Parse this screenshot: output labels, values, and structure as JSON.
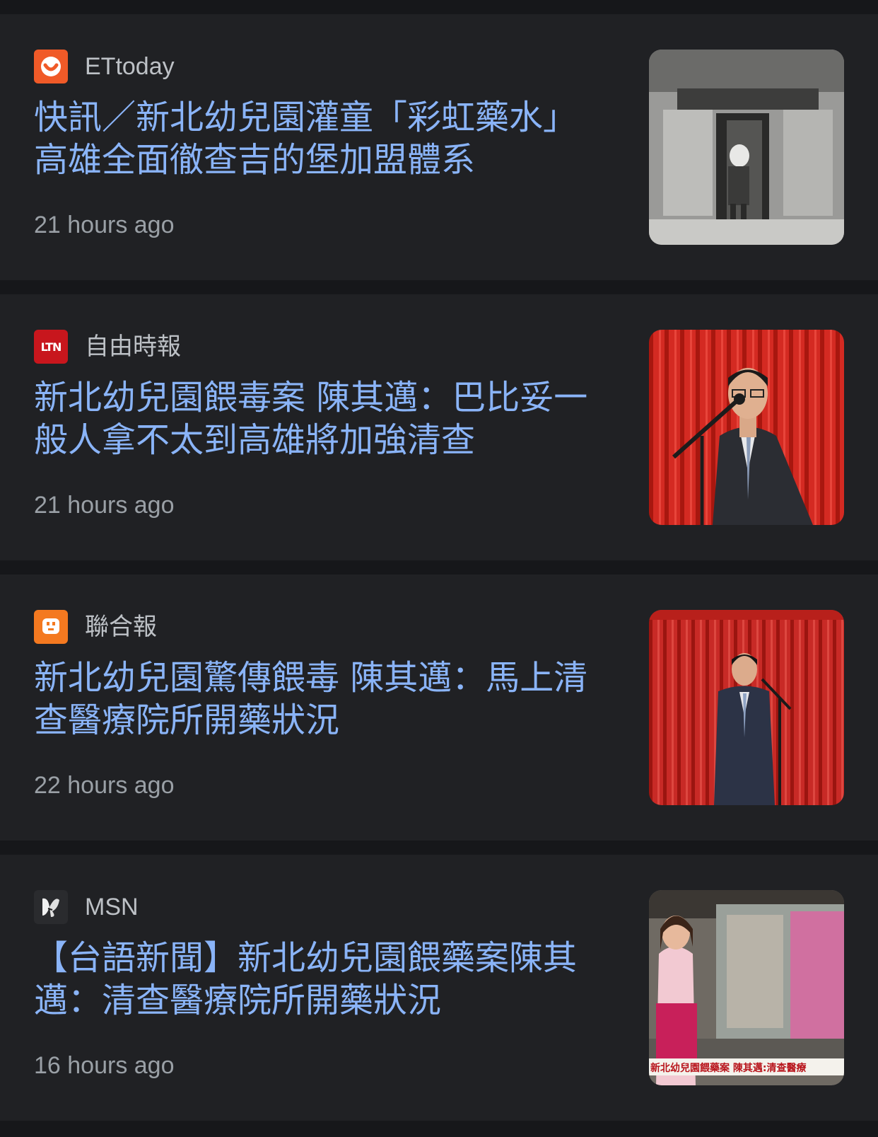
{
  "articles": [
    {
      "source": "ETtoday",
      "source_icon": "ettoday-logo-icon",
      "headline": "快訊／新北幼兒園灌童「彩虹藥水」　高雄全面徹查吉的堡加盟體系",
      "time": "21 hours ago",
      "thumbnail": "building-entrance-photo"
    },
    {
      "source": "自由時報",
      "source_icon": "ltn-logo-icon",
      "logo_text": "LTN",
      "headline": "新北幼兒園餵毒案 陳其邁：巴比妥一般人拿不太到高雄將加強清查",
      "time": "21 hours ago",
      "thumbnail": "speaker-at-podium-photo"
    },
    {
      "source": "聯合報",
      "source_icon": "udn-logo-icon",
      "headline": "新北幼兒園驚傳餵毒 陳其邁：馬上清查醫療院所開藥狀況",
      "time": "22 hours ago",
      "thumbnail": "speaker-standing-photo"
    },
    {
      "source": "MSN",
      "source_icon": "msn-logo-icon",
      "headline": "【台語新聞】新北幼兒園餵藥案陳其邁：清查醫療院所開藥狀況",
      "time": "16 hours ago",
      "thumbnail": "news-anchor-photo",
      "thumbnail_caption": "新北幼兒園餵藥案 陳其邁:清查醫療"
    }
  ],
  "colors": {
    "page_bg": "#16171a",
    "card_bg": "#202124",
    "headline": "#8ab4f8",
    "source_text": "#bdc1c6",
    "time_text": "#9aa0a6",
    "ettoday": "#f05a28",
    "ltn": "#c8161d",
    "udn": "#f47920"
  }
}
